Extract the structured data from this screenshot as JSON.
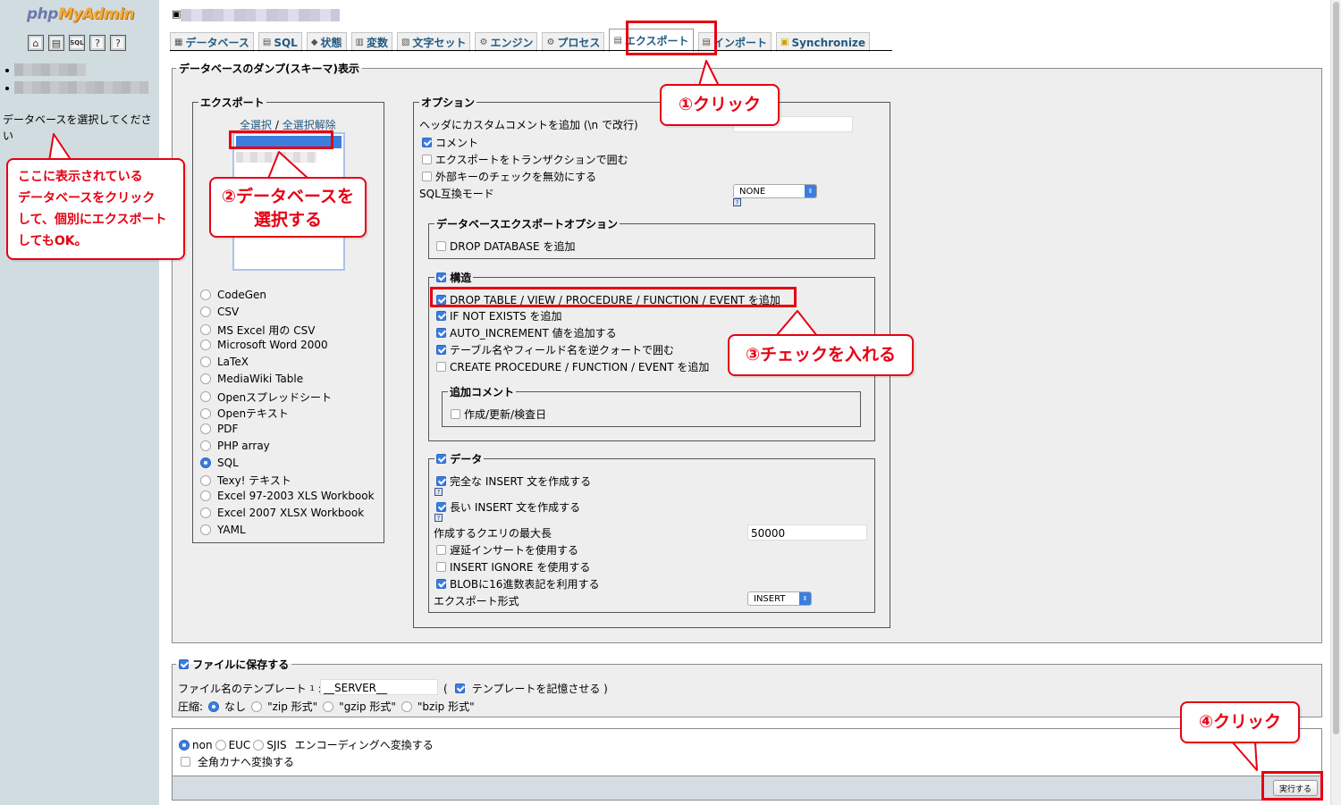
{
  "app": {
    "logo_php": "php",
    "logo_myadmin": "MyAdmin"
  },
  "quicklinks": [
    {
      "name": "home-icon",
      "glyph": "⌂"
    },
    {
      "name": "query-window-icon",
      "glyph": "▤"
    },
    {
      "name": "sql-icon",
      "glyph": "S"
    },
    {
      "name": "docs-icon",
      "glyph": "?"
    },
    {
      "name": "changelog-icon",
      "glyph": "?"
    }
  ],
  "sidebar": {
    "select_db_text": "データベースを選択してください"
  },
  "tabs": [
    {
      "label": "データベース",
      "icon": "database-icon",
      "active": false
    },
    {
      "label": "SQL",
      "icon": "sql-icon",
      "active": false
    },
    {
      "label": "状態",
      "icon": "status-icon",
      "active": false
    },
    {
      "label": "変数",
      "icon": "variables-icon",
      "active": false
    },
    {
      "label": "文字セット",
      "icon": "charset-icon",
      "active": false
    },
    {
      "label": "エンジン",
      "icon": "engine-icon",
      "active": false
    },
    {
      "label": "プロセス",
      "icon": "process-icon",
      "active": false
    },
    {
      "label": "エクスポート",
      "icon": "export-icon",
      "active": true
    },
    {
      "label": "インポート",
      "icon": "import-icon",
      "active": false
    },
    {
      "label": "Synchronize",
      "icon": "sync-icon",
      "active": false
    }
  ],
  "dump": {
    "legend": "データベースのダンプ(スキーマ)表示",
    "export": {
      "legend": "エクスポート",
      "select_all": "全選択",
      "separator": " / ",
      "deselect_all": "全選択解除",
      "formats": [
        {
          "label": "CodeGen",
          "selected": false
        },
        {
          "label": "CSV",
          "selected": false
        },
        {
          "label": "MS Excel 用の CSV",
          "selected": false
        },
        {
          "label": "Microsoft Word 2000",
          "selected": false
        },
        {
          "label": "LaTeX",
          "selected": false
        },
        {
          "label": "MediaWiki Table",
          "selected": false
        },
        {
          "label": "Openスプレッドシート",
          "selected": false
        },
        {
          "label": "Openテキスト",
          "selected": false
        },
        {
          "label": "PDF",
          "selected": false
        },
        {
          "label": "PHP array",
          "selected": false
        },
        {
          "label": "SQL",
          "selected": true
        },
        {
          "label": "Texy! テキスト",
          "selected": false
        },
        {
          "label": "Excel 97-2003 XLS Workbook",
          "selected": false
        },
        {
          "label": "Excel 2007 XLSX Workbook",
          "selected": false
        },
        {
          "label": "YAML",
          "selected": false
        }
      ]
    },
    "options": {
      "legend": "オプション",
      "header_comment_label": "ヘッダにカスタムコメントを追加 (\\n で改行)",
      "comments_label": "コメント",
      "transaction_label": "エクスポートをトランザクションで囲む",
      "fk_label": "外部キーのチェックを無効にする",
      "compat_label": "SQL互換モード",
      "compat_value": "NONE",
      "db_export_options_legend": "データベースエクスポートオプション",
      "drop_database_label": "DROP DATABASE を追加",
      "structure_legend": "構造",
      "drop_table_label": "DROP TABLE / VIEW / PROCEDURE / FUNCTION / EVENT を追加",
      "if_not_exists_label": "IF NOT EXISTS を追加",
      "auto_increment_label": "AUTO_INCREMENT 値を追加する",
      "backquotes_label": "テーブル名やフィールド名を逆クォートで囲む",
      "create_procedure_label": "CREATE PROCEDURE / FUNCTION / EVENT を追加",
      "add_comments_legend": "追加コメント",
      "dates_label": "作成/更新/検査日",
      "data_legend": "データ",
      "complete_insert_label": "完全な INSERT 文を作成する",
      "extended_insert_label": "長い INSERT 文を作成する",
      "max_query_label": "作成するクエリの最大長",
      "max_query_value": "50000",
      "delayed_label": "遅延インサートを使用する",
      "ignore_label": "INSERT IGNORE を使用する",
      "hex_label": "BLOBに16進数表記を利用する",
      "export_type_label": "エクスポート形式",
      "export_type_value": "INSERT"
    }
  },
  "save_file": {
    "legend": "ファイルに保存する",
    "template_label": "ファイル名のテンプレート",
    "template_sup": "1",
    "template_colon": " :",
    "template_value": "__SERVER__",
    "paren_open": "(",
    "remember_label": "テンプレートを記憶させる )",
    "compression_label": "圧縮:",
    "compression_options": [
      "なし",
      "\"zip 形式\"",
      "\"gzip 形式\"",
      "\"bzip 形式\""
    ]
  },
  "encoding": {
    "options": [
      "non",
      "EUC",
      "SJIS"
    ],
    "convert_label": "エンコーディングへ変換する",
    "kana_label": "全角カナへ変換する"
  },
  "go_button": "実行する",
  "annotations": {
    "step1": "①クリック",
    "step2_line1": "②データベースを",
    "step2_line2": "選択する",
    "step3": "③チェックを入れる",
    "step4": "④クリック",
    "sidebar_note_lines": [
      "ここに表示されている",
      "データベースをクリック",
      "して、個別にエクスポート",
      "してもOK。"
    ]
  },
  "colors": {
    "accent": "#3b7ee0",
    "annotation_red": "#e60012",
    "sidebar_bg": "#d0dce0",
    "link": "#235a81"
  }
}
